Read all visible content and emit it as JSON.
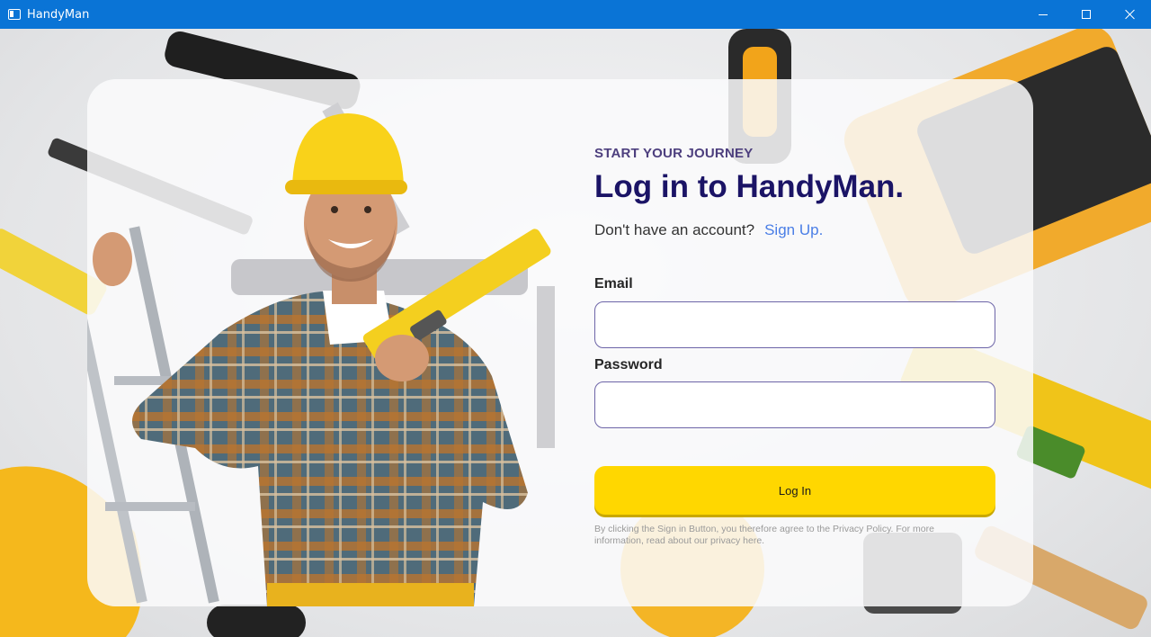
{
  "window": {
    "title": "HandyMan",
    "controls": {
      "minimize": "minimize-icon",
      "maximize": "maximize-icon",
      "close": "close-icon"
    }
  },
  "login": {
    "eyebrow": "START YOUR JOURNEY",
    "headline": "Log in to HandyMan.",
    "signup_prompt": "Don't have an account?",
    "signup_link": "Sign Up.",
    "email_label": "Email",
    "email_value": "",
    "password_label": "Password",
    "password_value": "",
    "login_button": "Log In",
    "legal_text": "By clicking the Sign in Button, you therefore agree to the Privacy Policy. For more information, read about our privacy here."
  },
  "colors": {
    "titlebar": "#0a74d6",
    "headline": "#1b1466",
    "eyebrow": "#4d3f7e",
    "link": "#4a7ee6",
    "button": "#ffd700",
    "input_border": "#6d65a8"
  }
}
